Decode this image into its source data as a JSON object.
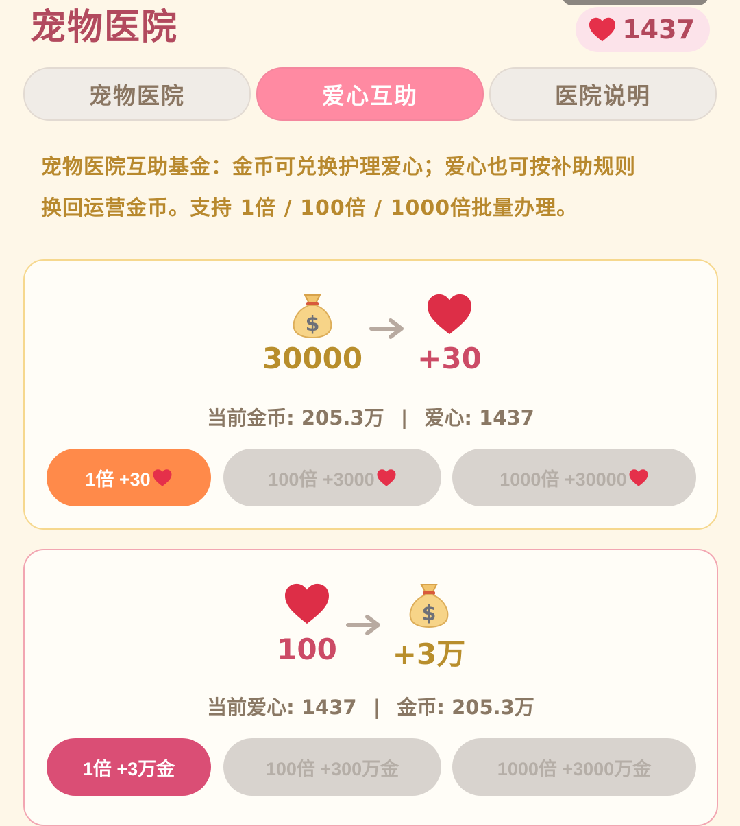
{
  "header": {
    "title": "宠物医院",
    "heart_count": "1437"
  },
  "tabs": [
    {
      "label": "宠物医院",
      "active": false
    },
    {
      "label": "爱心互助",
      "active": true
    },
    {
      "label": "医院说明",
      "active": false
    }
  ],
  "intro": {
    "line1": "宠物医院互助基金：金币可兑换护理爱心；爱心也可按补助规则",
    "line2": "换回运营金币。支持 1倍 / 100倍 / 1000倍批量办理。"
  },
  "coin_to_heart": {
    "cost": "30000",
    "gain": "+30",
    "status_prefix": "当前金币: ",
    "status_coins": "205.3万",
    "status_sep": "|",
    "status_heart_label": "爱心: ",
    "status_hearts": "1437",
    "buttons": [
      {
        "label": "1倍 +30",
        "enabled": true
      },
      {
        "label": "100倍 +3000",
        "enabled": false
      },
      {
        "label": "1000倍 +30000",
        "enabled": false
      }
    ]
  },
  "heart_to_coin": {
    "cost": "100",
    "gain": "+3万",
    "status_prefix": "当前爱心: ",
    "status_hearts": "1437",
    "status_sep": "|",
    "status_coin_label": "金币: ",
    "status_coins": "205.3万",
    "buttons": [
      {
        "label": "1倍 +3万金",
        "enabled": true
      },
      {
        "label": "100倍 +300万金",
        "enabled": false
      },
      {
        "label": "1000倍 +3000万金",
        "enabled": false
      }
    ]
  },
  "icons": {
    "coin_bag": "money-bag-icon",
    "heart": "heart-icon",
    "arrow": "right-arrow-icon"
  },
  "colors": {
    "background": "#FEF7E8",
    "title": "#B24A5E",
    "active_tab": "#FF8AA2",
    "gold": "#B88E2C",
    "pink": "#CC4B66",
    "orange_button": "#FF8A4A",
    "rose_button": "#DA4E75",
    "disabled_button": "#D8D3CE"
  }
}
